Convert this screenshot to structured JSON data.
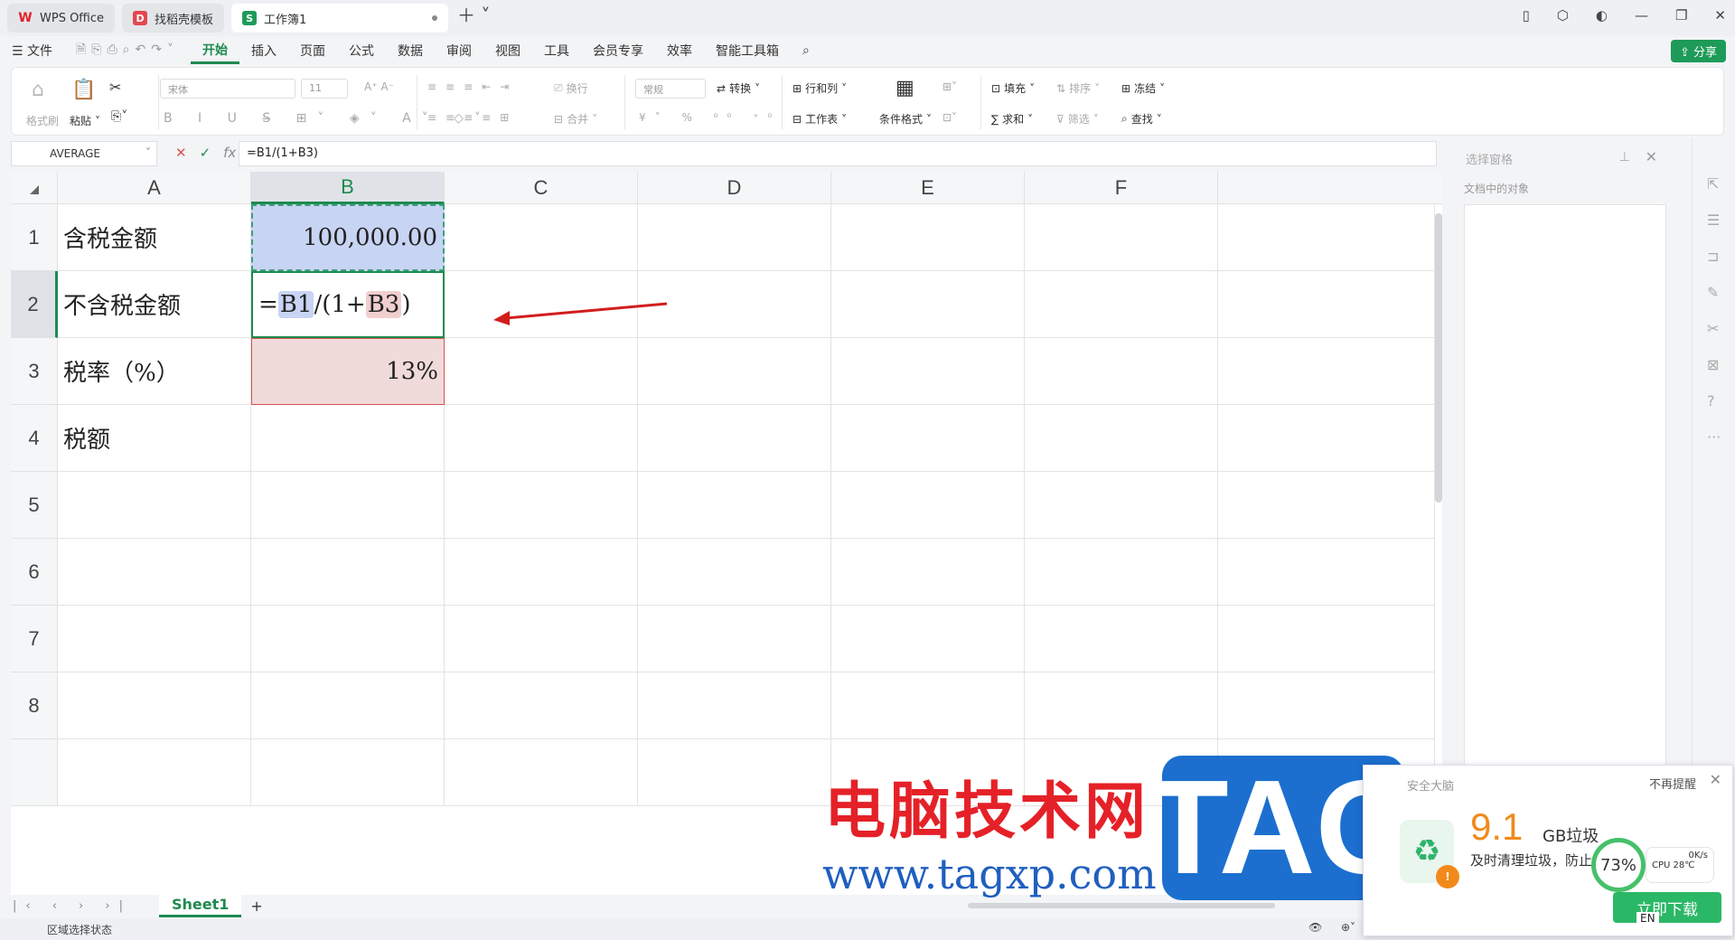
{
  "tabs": [
    {
      "label": "WPS Office",
      "logo": "W",
      "logo_color": "#e52128"
    },
    {
      "label": "找稻壳模板",
      "logo": "D",
      "logo_color": "#e24850"
    },
    {
      "label": "工作簿1",
      "logo": "S",
      "logo_color": "#1e9b58"
    }
  ],
  "menu": {
    "file": "文件",
    "items": [
      "开始",
      "插入",
      "页面",
      "公式",
      "数据",
      "审阅",
      "视图",
      "工具",
      "会员专享",
      "效率",
      "智能工具箱"
    ],
    "active": "开始",
    "share": "分享"
  },
  "ribbon": {
    "format_painter": "格式刷",
    "paste": "粘贴",
    "font_name": "宋体",
    "font_size": "11",
    "wrap": "换行",
    "merge": "合并",
    "number_format": "常规",
    "convert": "转换",
    "rows_cols": "行和列",
    "worksheet": "工作表",
    "cond_format": "条件格式",
    "fill": "填充",
    "sort": "排序",
    "freeze": "冻结",
    "sum": "求和",
    "filter": "筛选",
    "find": "查找"
  },
  "formula_bar": {
    "name_box": "AVERAGE",
    "formula": "=B1/(1+B3)"
  },
  "grid": {
    "columns": [
      "A",
      "B",
      "C",
      "D",
      "E",
      "F"
    ],
    "rows": [
      "1",
      "2",
      "3",
      "4",
      "5",
      "6",
      "7",
      "8"
    ],
    "selected_column": "B",
    "selected_row": "2",
    "cells": {
      "A1": "含税金额",
      "A2": "不含税金额",
      "A3": "税率（%）",
      "A4": "税额",
      "B1": "100,000.00",
      "B3": "13%"
    },
    "b2_formula_parts": [
      "=",
      "B1",
      "/(1+",
      "B3",
      ")"
    ]
  },
  "side_panel": {
    "title": "选择窗格",
    "subtitle": "文档中的对象"
  },
  "sheet_tab": "Sheet1",
  "status_text": "区域选择状态",
  "watermark": {
    "cn": "电脑技术网",
    "url": "www.tagxp.com",
    "tag": "TAG"
  },
  "popup": {
    "brand": "安全大脑",
    "dismiss": "不再提醒",
    "gb_value": "9.1",
    "gb_label": "GB垃圾",
    "desc": "及时清理垃圾，防止",
    "gauge": "73%",
    "net": "0K/s",
    "cpu": "CPU 28℃",
    "cta": "立即下载",
    "lang": "EN"
  }
}
